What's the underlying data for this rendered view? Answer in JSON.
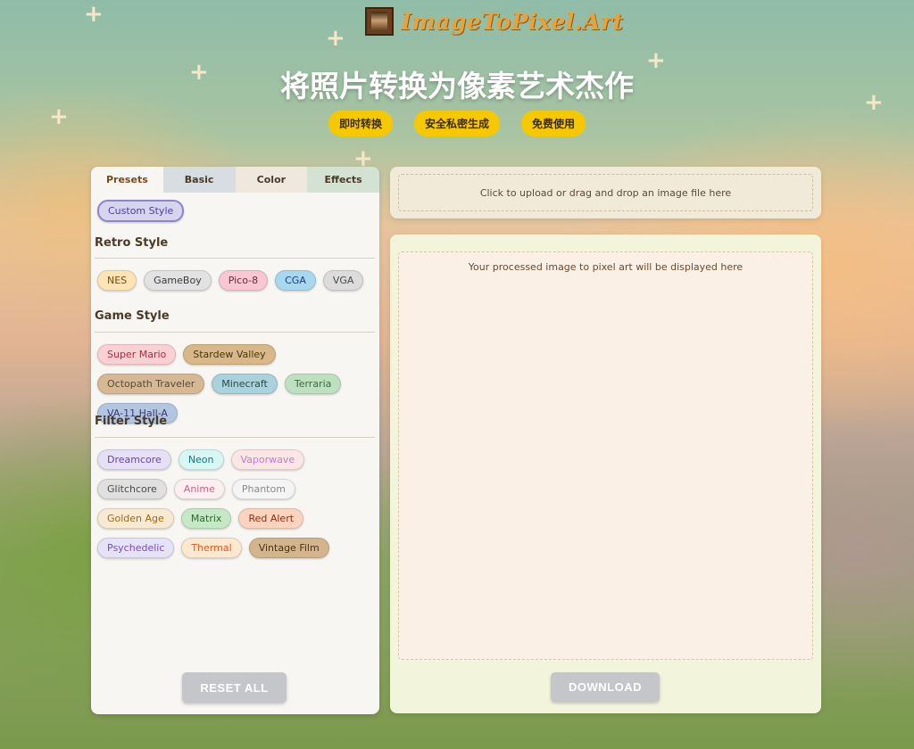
{
  "header": {
    "logo_text": "ImageToPixel.Art",
    "headline": "将照片转换为像素艺术杰作",
    "badges": [
      "即时转换",
      "安全私密生成",
      "免费使用"
    ]
  },
  "tabs": [
    {
      "label": "Presets",
      "active": true
    },
    {
      "label": "Basic"
    },
    {
      "label": "Color"
    },
    {
      "label": "Effects"
    }
  ],
  "presets": {
    "custom_label": "Custom Style",
    "sections": [
      {
        "title": "Retro Style",
        "items": [
          {
            "label": "NES",
            "bg": "#fde4b4",
            "fg": "#7a4a0a"
          },
          {
            "label": "GameBoy",
            "bg": "#e2e2e2",
            "fg": "#3a3a3a"
          },
          {
            "label": "Pico-8",
            "bg": "#f9c6d3",
            "fg": "#6a2a3a"
          },
          {
            "label": "CGA",
            "bg": "#a8d8ee",
            "fg": "#1a3a8a"
          },
          {
            "label": "VGA",
            "bg": "#dcdcdc",
            "fg": "#4a4a4a"
          }
        ]
      },
      {
        "title": "Game Style",
        "items": [
          {
            "label": "Super Mario",
            "bg": "#fbd0d4",
            "fg": "#b02a3a"
          },
          {
            "label": "Stardew Valley",
            "bg": "#d8b888",
            "fg": "#4a3418"
          },
          {
            "label": "Octopath Traveler",
            "bg": "#d6b894",
            "fg": "#5a4a3a"
          },
          {
            "label": "Minecraft",
            "bg": "#a9d2dc",
            "fg": "#2a4a4a"
          },
          {
            "label": "Terraria",
            "bg": "#bfe0c0",
            "fg": "#3a6a3a"
          },
          {
            "label": "VA-11 Hall-A",
            "bg": "#b2c6e4",
            "fg": "#3a3a6a"
          }
        ]
      },
      {
        "title": "Filter Style",
        "items": [
          {
            "label": "Dreamcore",
            "bg": "#e6e0f6",
            "fg": "#6a40b0"
          },
          {
            "label": "Neon",
            "bg": "#d8f6f4",
            "fg": "#0a7a7a"
          },
          {
            "label": "Vaporwave",
            "bg": "#fbe6e6",
            "fg": "#c07ad0"
          },
          {
            "label": "Glitchcore",
            "bg": "#e0e0e0",
            "fg": "#4a4a4a"
          },
          {
            "label": "Anime",
            "bg": "#fbeff2",
            "fg": "#d0608a"
          },
          {
            "label": "Phantom",
            "bg": "#f4f4f4",
            "fg": "#8a8a8a"
          },
          {
            "label": "Golden Age",
            "bg": "#f8ead2",
            "fg": "#9a6a10"
          },
          {
            "label": "Matrix",
            "bg": "#c6e8c6",
            "fg": "#2a6a2a"
          },
          {
            "label": "Red Alert",
            "bg": "#fbd4c0",
            "fg": "#9a2a0a"
          },
          {
            "label": "Psychedelic",
            "bg": "#e6e2f8",
            "fg": "#7a4ac0"
          },
          {
            "label": "Thermal",
            "bg": "#fde8d0",
            "fg": "#e05a20"
          },
          {
            "label": "Vintage Film",
            "bg": "#d4b48c",
            "fg": "#4a3418"
          }
        ]
      }
    ]
  },
  "reset_label": "RESET ALL",
  "upload_text": "Click to upload or drag and drop an image file here",
  "output_placeholder": "Your processed image to pixel art will be displayed here",
  "download_label": "DOWNLOAD"
}
